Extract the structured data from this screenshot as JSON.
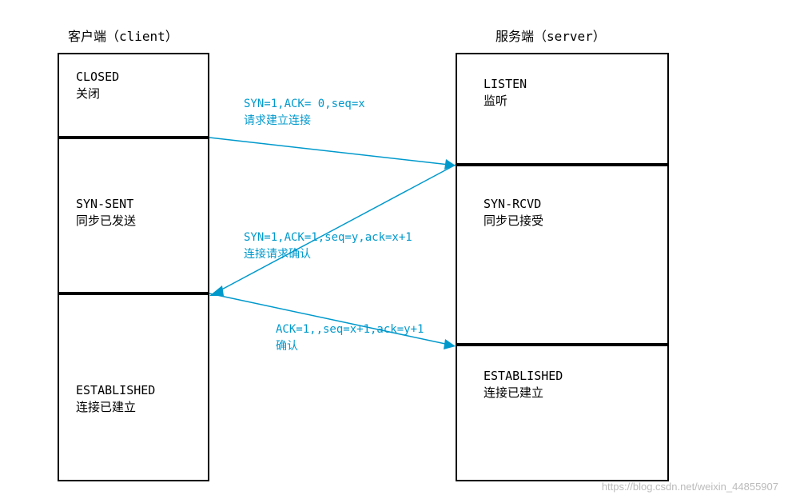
{
  "diagram": {
    "client_header": "客户端（client）",
    "server_header": "服务端（server）",
    "client_states": {
      "closed": {
        "en": "CLOSED",
        "cn": "关闭"
      },
      "syn_sent": {
        "en": "SYN-SENT",
        "cn": "同步已发送"
      },
      "established": {
        "en": "ESTABLISHED",
        "cn": "连接已建立"
      }
    },
    "server_states": {
      "listen": {
        "en": "LISTEN",
        "cn": "监听"
      },
      "syn_rcvd": {
        "en": "SYN-RCVD",
        "cn": "同步已接受"
      },
      "established": {
        "en": "ESTABLISHED",
        "cn": "连接已建立"
      }
    },
    "messages": {
      "msg1": {
        "params": "SYN=1,ACK= 0,seq=x",
        "desc": "请求建立连接"
      },
      "msg2": {
        "params": "SYN=1,ACK=1,seq=y,ack=x+1",
        "desc": "连接请求确认"
      },
      "msg3": {
        "params": "ACK=1,,seq=x+1,ack=y+1",
        "desc": "确认"
      }
    },
    "watermark": "https://blog.csdn.net/weixin_44855907"
  }
}
